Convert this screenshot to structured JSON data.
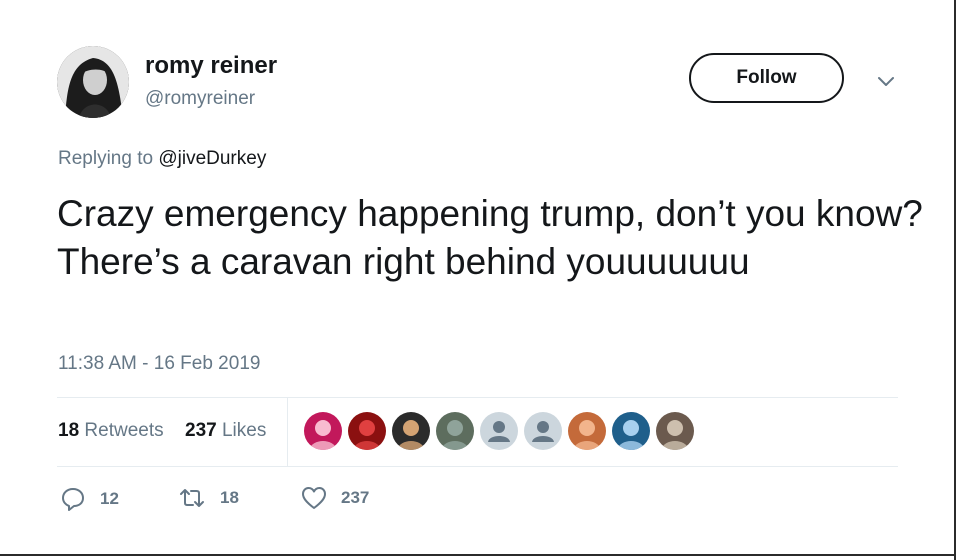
{
  "author": {
    "display_name": "romy reiner",
    "handle": "@romyreiner"
  },
  "follow_button": {
    "label": "Follow"
  },
  "reply_context": {
    "prefix": "Replying to",
    "handle": "@jiveDurkey"
  },
  "tweet": {
    "text": "Crazy emergency happening trump, don’t you know? There’s a caravan right behind youuuuuuu",
    "timestamp": "11:38 AM - 16 Feb 2019"
  },
  "stats": {
    "retweets_count": "18",
    "retweets_label": "Retweets",
    "likes_count": "237",
    "likes_label": "Likes"
  },
  "liker_avatars": [
    {
      "colors": [
        "#c2185b",
        "#f8bbd0"
      ],
      "glyph": "you"
    },
    {
      "colors": [
        "#8b1010",
        "#e04040"
      ]
    },
    {
      "colors": [
        "#2b2b2b",
        "#d4a373"
      ]
    },
    {
      "colors": [
        "#5d6d5e",
        "#8fa39a"
      ]
    },
    {
      "colors": [
        "#ccd6dd",
        "#aab8c2"
      ],
      "default": true
    },
    {
      "colors": [
        "#ccd6dd",
        "#aab8c2"
      ],
      "default": true
    },
    {
      "colors": [
        "#c46a3a",
        "#f2b48c"
      ]
    },
    {
      "colors": [
        "#1f5f8b",
        "#a7d0ef"
      ]
    },
    {
      "colors": [
        "#6b5a4e",
        "#cdbfae"
      ]
    }
  ],
  "actions": {
    "reply_count": "12",
    "retweet_count": "18",
    "like_count": "237"
  },
  "icons": {
    "reply": "reply-icon",
    "retweet": "retweet-icon",
    "like": "heart-icon",
    "more": "chevron-down-icon"
  },
  "colors": {
    "text": "#14171a",
    "secondary": "#657786",
    "divider": "#e6ecf0"
  }
}
